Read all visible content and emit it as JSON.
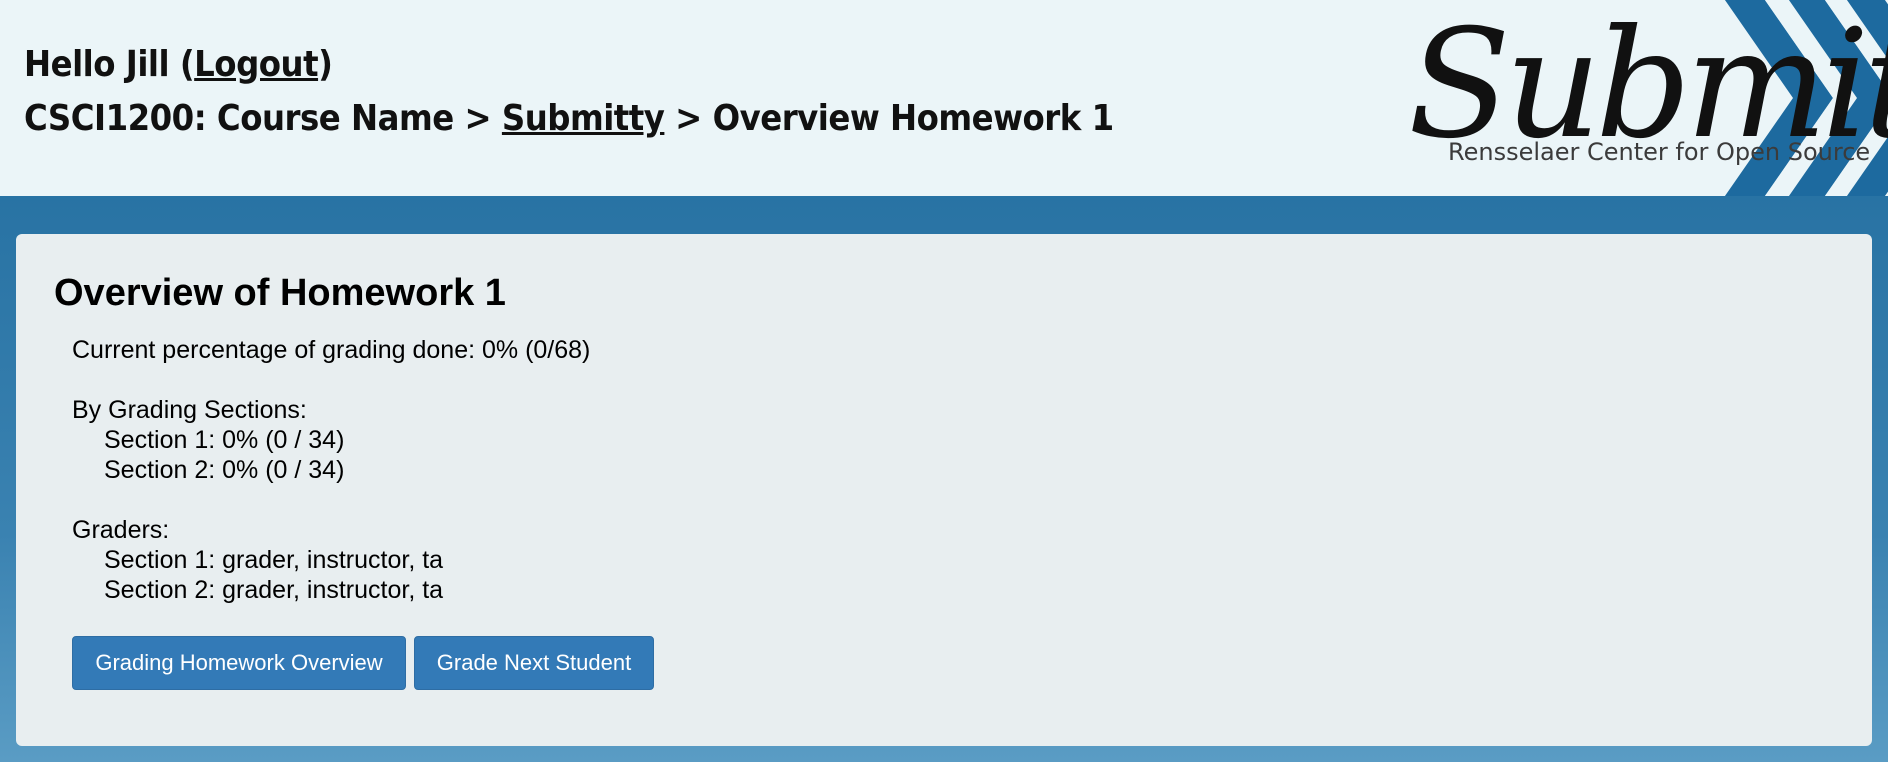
{
  "header": {
    "greeting_prefix": "Hello Jill (",
    "logout_label": "Logout",
    "greeting_suffix": ")",
    "breadcrumb": {
      "course": "CSCI1200: Course Name",
      "separator": " > ",
      "submitty_link": "Submitty",
      "page": "Overview Homework 1"
    }
  },
  "logo": {
    "wordmark": "Submitty",
    "tagline": "Rensselaer Center for Open Source"
  },
  "panel": {
    "title": "Overview of Homework 1",
    "current_percentage": "Current percentage of grading done: 0% (0/68)",
    "by_sections_label": "By Grading Sections:",
    "sections": [
      "Section 1: 0% (0 / 34)",
      "Section 2: 0% (0 / 34)"
    ],
    "graders_label": "Graders:",
    "graders": [
      "Section 1: grader, instructor, ta",
      "Section 2: grader, instructor, ta"
    ],
    "buttons": {
      "overview": "Grading Homework Overview",
      "next": "Grade Next Student"
    }
  },
  "colors": {
    "header_bg": "#ebf5f8",
    "accent": "#337ab7",
    "logo_stripes": "#1d6a9f",
    "panel_bg": "#e8eef0"
  }
}
